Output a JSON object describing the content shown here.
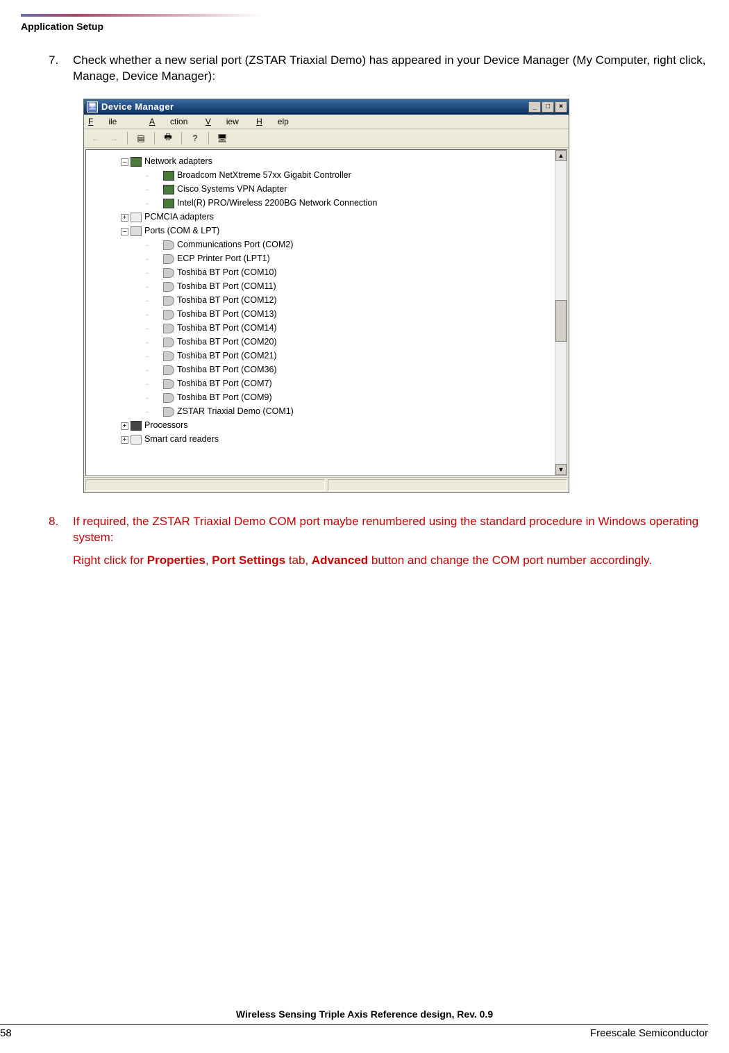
{
  "header": {
    "section": "Application Setup"
  },
  "steps": {
    "s7": {
      "num": "7.",
      "text": "Check whether a new serial port (ZSTAR Triaxial Demo) has appeared in your Device Manager (My Computer, right click, Manage, Device Manager):"
    },
    "s8": {
      "num": "8.",
      "text1": "If required, the ZSTAR Triaxial Demo COM port maybe renumbered using the standard procedure in Windows operating system:",
      "text2_a": "Right click for ",
      "text2_b": "Properties",
      "text2_c": ", ",
      "text2_d": "Port Settings",
      "text2_e": " tab, ",
      "text2_f": "Advanced",
      "text2_g": " button and change the COM port number accordingly."
    }
  },
  "devmgr": {
    "title": "Device Manager",
    "menu": {
      "file": "File",
      "action": "Action",
      "view": "View",
      "help": "Help"
    },
    "tree": {
      "network_adapters": "Network adapters",
      "na1": "Broadcom NetXtreme 57xx Gigabit Controller",
      "na2": "Cisco Systems VPN Adapter",
      "na3": "Intel(R) PRO/Wireless 2200BG Network Connection",
      "pcmcia": "PCMCIA adapters",
      "ports": "Ports (COM & LPT)",
      "p1": "Communications Port (COM2)",
      "p2": "ECP Printer Port (LPT1)",
      "p3": "Toshiba BT Port (COM10)",
      "p4": "Toshiba BT Port (COM11)",
      "p5": "Toshiba BT Port (COM12)",
      "p6": "Toshiba BT Port (COM13)",
      "p7": "Toshiba BT Port (COM14)",
      "p8": "Toshiba BT Port (COM20)",
      "p9": "Toshiba BT Port (COM21)",
      "p10": "Toshiba BT Port (COM36)",
      "p11": "Toshiba BT Port (COM7)",
      "p12": "Toshiba BT Port (COM9)",
      "p13": "ZSTAR Triaxial Demo (COM1)",
      "processors": "Processors",
      "smartcard": "Smart card readers"
    }
  },
  "footer": {
    "doc": "Wireless Sensing Triple Axis Reference design, Rev. 0.9",
    "page": "58",
    "company": "Freescale Semiconductor"
  }
}
